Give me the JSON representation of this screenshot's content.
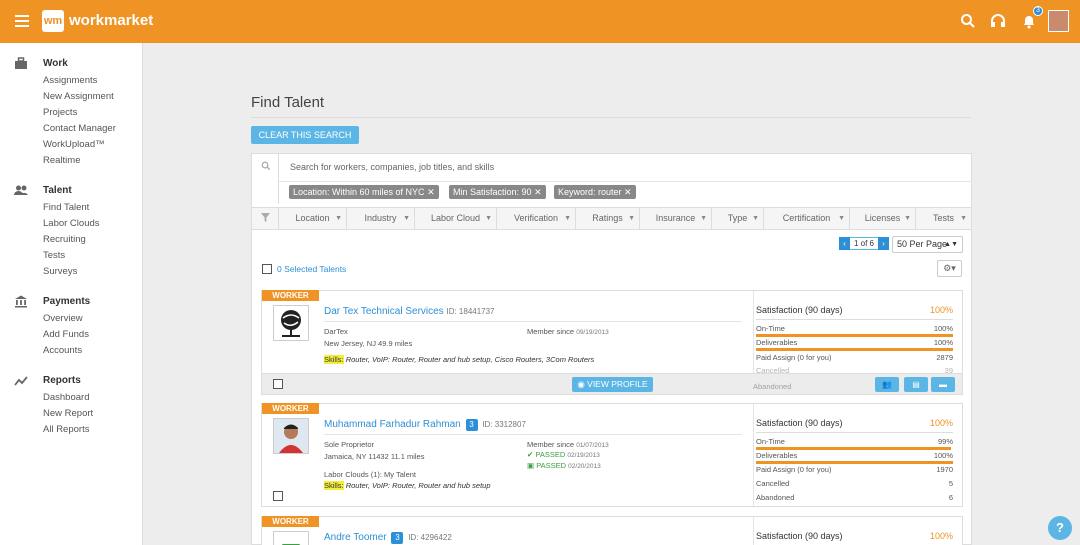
{
  "app": {
    "logo_mark": "wm",
    "name": "workmarket",
    "notification_count": "3"
  },
  "sidebar": {
    "sections": [
      {
        "title": "Work",
        "icon": "briefcase-icon",
        "items": [
          "Assignments",
          "New Assignment",
          "Projects",
          "Contact Manager",
          "WorkUpload™",
          "Realtime"
        ]
      },
      {
        "title": "Talent",
        "icon": "people-icon",
        "items": [
          "Find Talent",
          "Labor Clouds",
          "Recruiting",
          "Tests",
          "Surveys"
        ]
      },
      {
        "title": "Payments",
        "icon": "bank-icon",
        "items": [
          "Overview",
          "Add Funds",
          "Accounts"
        ]
      },
      {
        "title": "Reports",
        "icon": "trend-icon",
        "items": [
          "Dashboard",
          "New Report",
          "All Reports"
        ]
      }
    ]
  },
  "page": {
    "title": "Find Talent",
    "clear_label": "CLEAR THIS SEARCH"
  },
  "search": {
    "placeholder": "Search for workers, companies, job titles, and skills",
    "chips": [
      "Location: Within 60 miles of NYC",
      "Min Satisfaction: 90",
      "Keyword: router"
    ]
  },
  "filters": [
    "Location",
    "Industry",
    "Labor Cloud",
    "Verification",
    "Ratings",
    "Insurance",
    "Type",
    "Certification",
    "Licenses",
    "Tests"
  ],
  "pagination": {
    "label": "1 of 6",
    "per_page": "50 Per Page"
  },
  "selected_label": "0 Selected Talents",
  "cards": [
    {
      "tag": "WORKER",
      "name": "Dar Tex Technical Services",
      "id_text": "ID: 18441737",
      "company": "DarTex",
      "location": "New Jersey, NJ 49.9 miles",
      "member_since_label": "Member since",
      "member_since": "09/19/2013",
      "skills_label": "Skills:",
      "skills_text": "Router, VoIP: Router, Router and hub setup, Cisco Routers, 3Com Routers",
      "satisfaction_label": "Satisfaction (90 days)",
      "satisfaction": "100%",
      "stats": [
        {
          "label": "On-Time",
          "value": "100%",
          "bar": 1.0
        },
        {
          "label": "Deliverables",
          "value": "100%",
          "bar": 1.0
        },
        {
          "label": "Paid Assign (0 for you)",
          "value": "2879"
        },
        {
          "label": "Cancelled",
          "value": "39"
        },
        {
          "label": "Abandoned",
          "value": ""
        }
      ],
      "view_label": "VIEW PROFILE"
    },
    {
      "tag": "WORKER",
      "name": "Muhammad Farhadur Rahman",
      "badge": "3",
      "id_text": "ID: 3312807",
      "company": "Sole Proprietor",
      "location": "Jamaica, NY 11432 11.1 miles",
      "member_since_label": "Member since",
      "member_since": "01/07/2013",
      "passed": [
        {
          "label": "PASSED",
          "date": "02/19/2013"
        },
        {
          "label": "PASSED",
          "date": "02/20/2013"
        }
      ],
      "labor_clouds": "Labor Clouds (1): My Talent",
      "skills_label": "Skills:",
      "skills_text": "Router, VoIP: Router, Router and hub setup",
      "satisfaction_label": "Satisfaction (90 days)",
      "satisfaction": "100%",
      "stats": [
        {
          "label": "On-Time",
          "value": "99%",
          "bar": 0.99
        },
        {
          "label": "Deliverables",
          "value": "100%",
          "bar": 1.0
        },
        {
          "label": "Paid Assign (0 for you)",
          "value": "1970"
        },
        {
          "label": "Cancelled",
          "value": "5"
        },
        {
          "label": "Abandoned",
          "value": "6"
        }
      ]
    },
    {
      "tag": "WORKER",
      "name": "Andre Toomer",
      "badge": "3",
      "id_text": "ID: 4296422",
      "satisfaction_label": "Satisfaction (90 days)",
      "satisfaction": "100%"
    }
  ],
  "colors": {
    "brand": "#ef9324",
    "accent": "#5bb6e6",
    "link": "#2d8fd6"
  }
}
